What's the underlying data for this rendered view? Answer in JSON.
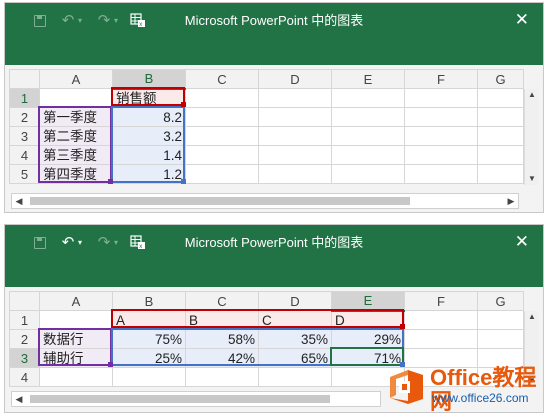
{
  "window1": {
    "title": "Microsoft PowerPoint 中的图表",
    "columns": [
      "",
      "A",
      "B",
      "C",
      "D",
      "E",
      "F",
      "G"
    ],
    "rows": [
      {
        "num": "1",
        "cells": [
          "",
          "销售额",
          "",
          "",
          "",
          "",
          ""
        ]
      },
      {
        "num": "2",
        "cells": [
          "第一季度",
          "8.2",
          "",
          "",
          "",
          "",
          ""
        ]
      },
      {
        "num": "3",
        "cells": [
          "第二季度",
          "3.2",
          "",
          "",
          "",
          "",
          ""
        ]
      },
      {
        "num": "4",
        "cells": [
          "第三季度",
          "1.4",
          "",
          "",
          "",
          "",
          ""
        ]
      },
      {
        "num": "5",
        "cells": [
          "第四季度",
          "1.2",
          "",
          "",
          "",
          "",
          ""
        ]
      }
    ]
  },
  "window2": {
    "title": "Microsoft PowerPoint 中的图表",
    "columns": [
      "",
      "A",
      "B",
      "C",
      "D",
      "E",
      "F",
      "G"
    ],
    "rows": [
      {
        "num": "1",
        "cells": [
          "",
          "A",
          "B",
          "C",
          "D",
          "",
          ""
        ]
      },
      {
        "num": "2",
        "cells": [
          "数据行",
          "75%",
          "58%",
          "35%",
          "29%",
          "",
          ""
        ]
      },
      {
        "num": "3",
        "cells": [
          "辅助行",
          "25%",
          "42%",
          "65%",
          "71%",
          "",
          ""
        ]
      },
      {
        "num": "4",
        "cells": [
          "",
          "",
          "",
          "",
          "",
          "",
          ""
        ]
      }
    ]
  },
  "toolbar": {
    "save_icon": "save-icon",
    "undo_icon": "undo-icon",
    "redo_icon": "redo-icon",
    "edit_data_icon": "edit-data-in-excel-icon",
    "close_glyph": "✕"
  },
  "watermark": {
    "name": "Office教程网",
    "url": "www.office26.com"
  },
  "colors": {
    "titlebar": "#217346",
    "series_blue": "#4472c4",
    "category_purple": "#7030a0",
    "name_red": "#c00000",
    "watermark_orange": "#e8590c"
  }
}
